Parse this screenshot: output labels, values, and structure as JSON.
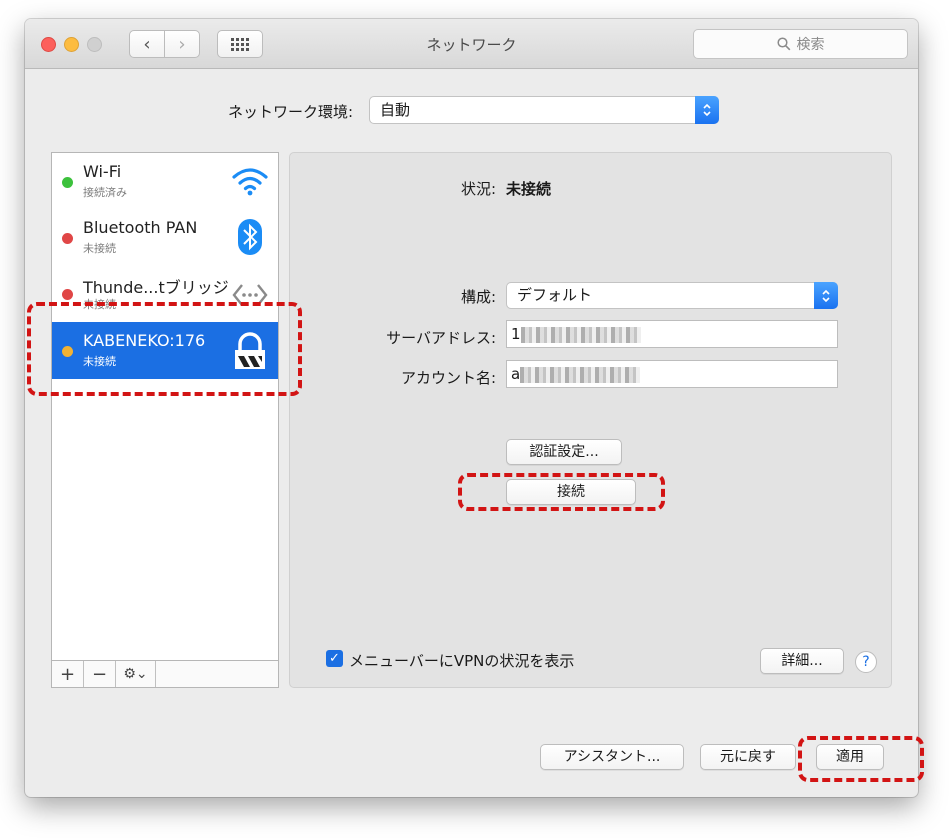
{
  "window": {
    "title": "ネットワーク",
    "search_placeholder": "検索"
  },
  "location": {
    "label": "ネットワーク環境:",
    "value": "自動"
  },
  "services": [
    {
      "name": "Wi-Fi",
      "status": "接続済み",
      "dot_color": "#3cc13c",
      "icon": "wifi-icon"
    },
    {
      "name": "Bluetooth PAN",
      "status": "未接続",
      "dot_color": "#e04646",
      "icon": "bluetooth-icon"
    },
    {
      "name": "Thunde...tブリッジ",
      "status": "未接続",
      "dot_color": "#e04646",
      "icon": "thunderbolt-bridge-icon"
    },
    {
      "name": "KABENEKO:176",
      "status": "未接続",
      "dot_color": "#f2b233",
      "icon": "vpn-lock-icon",
      "selected": true
    }
  ],
  "sidebar_toolbar": {
    "add": "+",
    "remove": "−",
    "gear": "⚙⌄"
  },
  "detail": {
    "status_label": "状況:",
    "status_value": "未接続",
    "config_label": "構成:",
    "config_value": "デフォルト",
    "server_label": "サーバアドレス:",
    "server_value": "1",
    "account_label": "アカウント名:",
    "account_value": "a",
    "auth_button": "認証設定...",
    "connect_button": "接続",
    "show_vpn_label": "メニューバーにVPNの状況を表示",
    "show_vpn_checked": true,
    "advanced_button": "詳細...",
    "help": "?"
  },
  "footer": {
    "assistant_button": "アシスタント...",
    "revert_button": "元に戻す",
    "apply_button": "適用"
  },
  "colors": {
    "selection": "#1b6fe3",
    "annotation": "#d21414"
  }
}
